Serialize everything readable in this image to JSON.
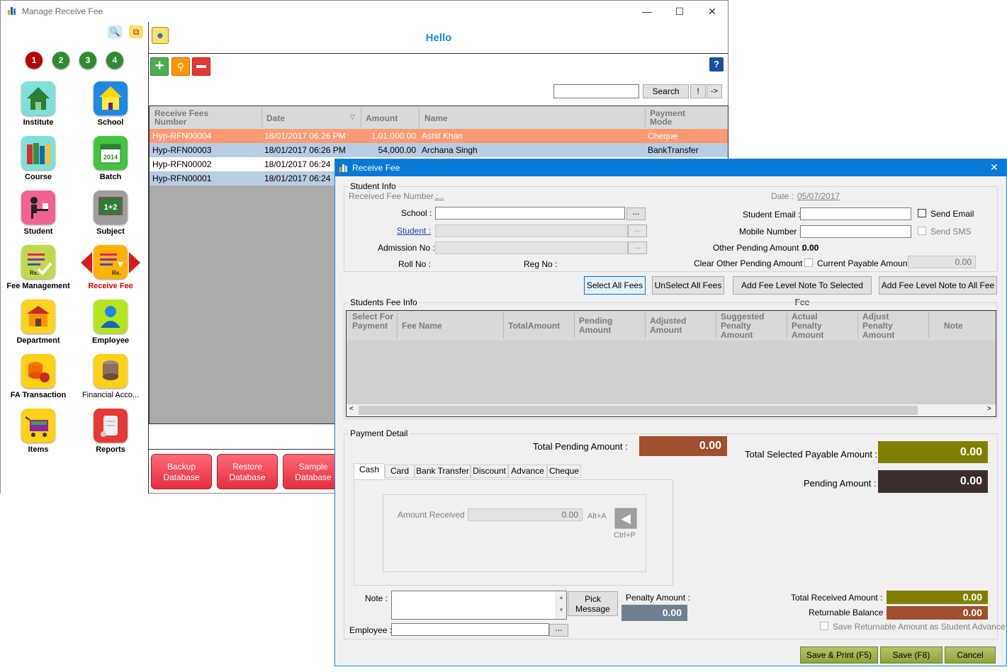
{
  "main_window": {
    "title": "Manage Receive Fee",
    "minimize": "—",
    "maximize": "☐",
    "close": "✕"
  },
  "sidebar": {
    "steps": [
      "1",
      "2",
      "3",
      "4"
    ],
    "items": [
      {
        "label": "Institute",
        "icon": "house-icon"
      },
      {
        "label": "School",
        "icon": "school-building-icon"
      },
      {
        "label": "Course",
        "icon": "books-icon"
      },
      {
        "label": "Batch",
        "icon": "calendar-icon"
      },
      {
        "label": "Student",
        "icon": "student-desk-icon"
      },
      {
        "label": "Subject",
        "icon": "blackboard-icon"
      },
      {
        "label": "Fee Management",
        "icon": "fee-list-icon"
      },
      {
        "label": "Receive Fee",
        "icon": "receive-fee-icon"
      },
      {
        "label": "Department",
        "icon": "department-icon"
      },
      {
        "label": "Employee",
        "icon": "employee-icon"
      },
      {
        "label": "FA Transaction",
        "icon": "coins-icon"
      },
      {
        "label": "Financial Acco...",
        "icon": "coin-stack-icon"
      },
      {
        "label": "Items",
        "icon": "cart-icon"
      },
      {
        "label": "Reports",
        "icon": "scroll-icon"
      }
    ],
    "selected_color": "#e00000"
  },
  "header": {
    "greeting": "Hello",
    "help": "?"
  },
  "search": {
    "button": "Search",
    "bang": "!",
    "arrow": "->"
  },
  "grid": {
    "columns": [
      "Receive Fees Number",
      "Date",
      "Amount",
      "Name",
      "Payment Mode"
    ],
    "rows": [
      {
        "number": "Hyp-RFN00004",
        "date": "18/01/2017 06:26 PM",
        "amount": "1,01,000.00",
        "name": "Ashif Khan",
        "mode": "Cheque"
      },
      {
        "number": "Hyp-RFN00003",
        "date": "18/01/2017 06:26 PM",
        "amount": "54,000.00",
        "name": "Archana Singh",
        "mode": "BankTransfer"
      },
      {
        "number": "Hyp-RFN00002",
        "date": "18/01/2017 06:24",
        "amount": "",
        "name": "",
        "mode": ""
      },
      {
        "number": "Hyp-RFN00001",
        "date": "18/01/2017 06:24",
        "amount": "",
        "name": "",
        "mode": ""
      }
    ]
  },
  "footer_buttons": {
    "backup": "Backup Database",
    "restore": "Restore Database",
    "sample": "Sample Database"
  },
  "dialog": {
    "title": "Receive Fee",
    "close": "✕",
    "student_info": {
      "group": "Student Info",
      "received_fee_number_label": "Received Fee Number :",
      "received_fee_number_value": "....",
      "date_label": "Date :",
      "date_value": "05/07/2017",
      "school_label": "School :",
      "student_label": "Student :",
      "admission_label": "Admission No :",
      "roll_label": "Roll No :",
      "reg_label": "Reg No :",
      "student_email_label": "Student Email :",
      "mobile_label": "Mobile Number :",
      "other_pending_label": "Other Pending Amount :",
      "other_pending_value": "0.00",
      "clear_other_label": "Clear Other Pending Amount :",
      "current_payable_label": "Current Payable Amount :",
      "current_payable_value": "0.00",
      "send_email": "Send Email",
      "send_sms": "Send SMS",
      "browse": "..."
    },
    "actions": {
      "select_all": "Select All Fees",
      "unselect_all": "UnSelect All Fees",
      "add_note_selected": "Add Fee Level Note To Selected Fee",
      "add_note_all": "Add  Fee Level Note to All Fee"
    },
    "fee_info": {
      "group": "Students Fee Info",
      "columns": [
        "Select For Payment",
        "Fee Name",
        "TotalAmount",
        "Pending Amount",
        "Adjusted Amount",
        "Suggested Penalty Amount",
        "Actual Penalty Amount",
        "Adjust Penalty Amount",
        "Note"
      ]
    },
    "payment": {
      "group": "Payment Detail",
      "total_pending_label": "Total Pending Amount :",
      "total_pending_value": "0.00",
      "total_selected_label": "Total Selected Payable Amount :",
      "total_selected_value": "0.00",
      "pending_label": "Pending Amount :",
      "pending_value": "0.00",
      "tabs": [
        "Cash",
        "Card",
        "Bank Transfer",
        "Discount",
        "Advance",
        "Cheque"
      ],
      "amount_received_label": "Amount Received :",
      "amount_received_value": "0.00",
      "alt_a": "Alt+A",
      "ctrl_p": "Ctrl+P",
      "note_label": "Note :",
      "pick_message": "Pick Message",
      "penalty_label": "Penalty Amount :",
      "penalty_value": "0.00",
      "employee_label": "Employee :",
      "total_received_label": "Total Received  Amount  :",
      "total_received_value": "0.00",
      "returnable_label": "Returnable Balance :",
      "returnable_value": "0.00",
      "save_returnable": "Save Returnable Amount as Student Advance",
      "colors": {
        "pending_brown": "#a0502e",
        "olive": "#808000",
        "dark": "#3b2e2c",
        "penalty_gray": "#708090"
      }
    },
    "buttons": {
      "save_print": "Save & Print (F5)",
      "save": "Save (F8)",
      "cancel": "Cancel"
    }
  }
}
